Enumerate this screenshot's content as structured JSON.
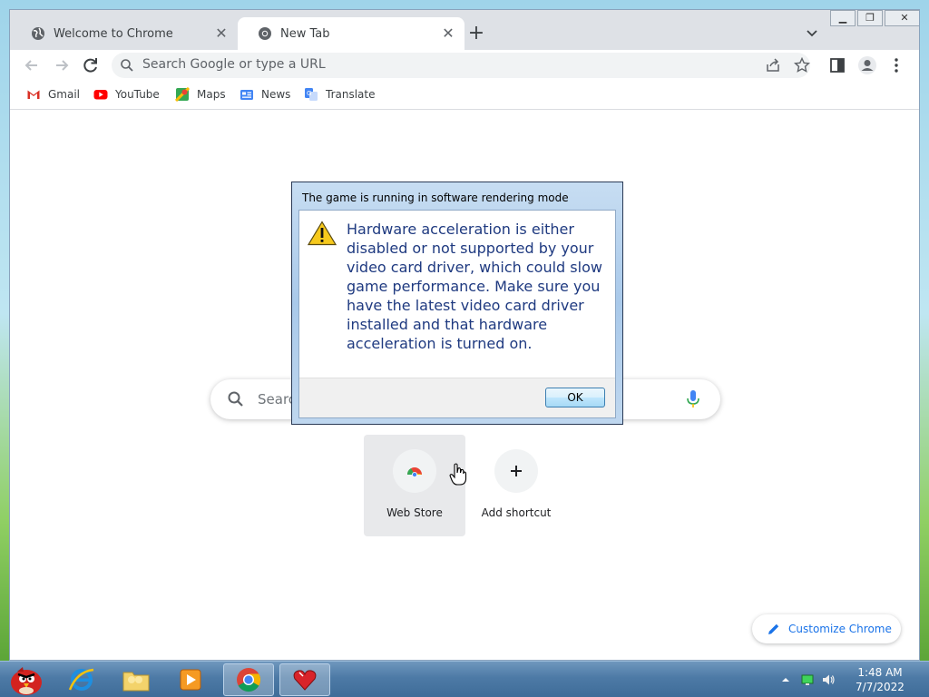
{
  "browser": {
    "tabs": [
      {
        "title": "Welcome to Chrome",
        "active": false,
        "icon": "globe-icon"
      },
      {
        "title": "New Tab",
        "active": true,
        "icon": "chrome-icon"
      }
    ],
    "omnibox_placeholder": "Search Google or type a URL",
    "bookmarks": [
      {
        "label": "Gmail",
        "icon": "gmail-icon"
      },
      {
        "label": "YouTube",
        "icon": "youtube-icon"
      },
      {
        "label": "Maps",
        "icon": "maps-icon"
      },
      {
        "label": "News",
        "icon": "news-icon"
      },
      {
        "label": "Translate",
        "icon": "translate-icon"
      }
    ]
  },
  "ntp": {
    "search_placeholder": "Searc",
    "shortcuts": [
      {
        "label": "Web Store",
        "icon": "chrome-web-store-icon"
      },
      {
        "label": "Add shortcut",
        "icon": "plus-icon"
      }
    ],
    "customize_label": "Customize Chrome"
  },
  "dialog": {
    "title": "The game is running in software rendering mode",
    "message": "Hardware acceleration is either disabled or not supported by your video card driver, which could slow game performance. Make sure you have the latest video card driver installed and that hardware acceleration is turned on.",
    "ok_label": "OK",
    "icon": "warning-icon"
  },
  "taskbar": {
    "apps": [
      "angry-birds-start-icon",
      "internet-explorer-icon",
      "folder-icon",
      "media-player-icon",
      "chrome-icon",
      "game-heart-icon"
    ],
    "time": "1:48 AM",
    "date": "7/7/2022"
  },
  "colors": {
    "accent": "#1a73e8",
    "dialog_text": "#1f3a80",
    "taskbar": "#4d7aa6"
  }
}
